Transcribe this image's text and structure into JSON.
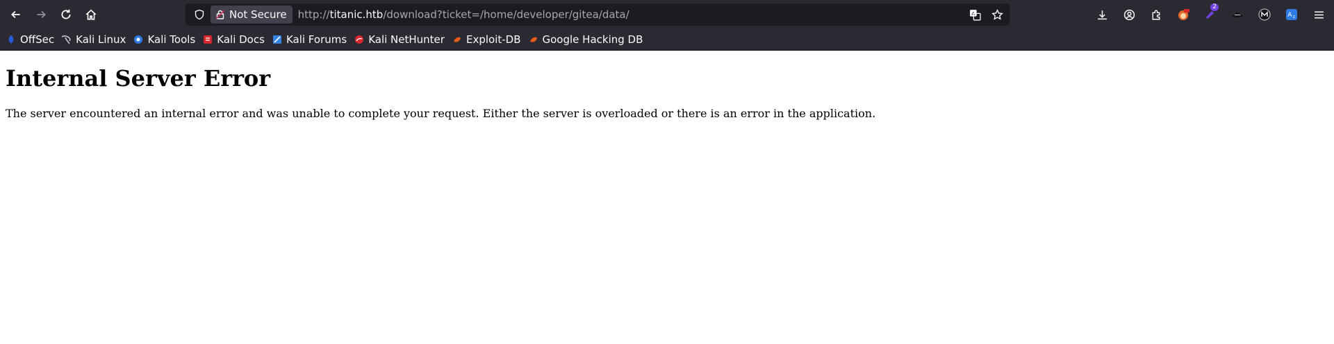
{
  "browser": {
    "security_label": "Not Secure",
    "url": {
      "scheme": "http://",
      "host": "titanic.htb",
      "path": "/download?ticket=/home/developer/gitea/data/"
    },
    "icons": {
      "back": "back-arrow-icon",
      "forward": "forward-arrow-icon",
      "reload": "reload-icon",
      "home": "home-icon",
      "shield": "tracking-protection-shield-icon",
      "lock": "insecure-lock-icon",
      "translate": "translate-icon",
      "bookmark_star": "star-icon",
      "downloads": "download-icon",
      "account": "account-icon",
      "extensions": "extensions-icon",
      "menu": "hamburger-menu-icon"
    },
    "extension_badge": "2"
  },
  "bookmarks": [
    {
      "label": "OffSec",
      "color": "#2a5ad8"
    },
    {
      "label": "Kali Linux",
      "color": "#cfd3dc"
    },
    {
      "label": "Kali Tools",
      "color": "#2f7be6"
    },
    {
      "label": "Kali Docs",
      "color": "#d8262d"
    },
    {
      "label": "Kali Forums",
      "color": "#3584e4"
    },
    {
      "label": "Kali NetHunter",
      "color": "#d8262d"
    },
    {
      "label": "Exploit-DB",
      "color": "#e85c1c"
    },
    {
      "label": "Google Hacking DB",
      "color": "#e85c1c"
    }
  ],
  "page": {
    "heading": "Internal Server Error",
    "message": "The server encountered an internal error and was unable to complete your request. Either the server is overloaded or there is an error in the application."
  },
  "colors": {
    "toolbar_bg": "#2b2a33",
    "urlbar_bg": "#1c1b22",
    "text_light": "#fbfbfe"
  }
}
